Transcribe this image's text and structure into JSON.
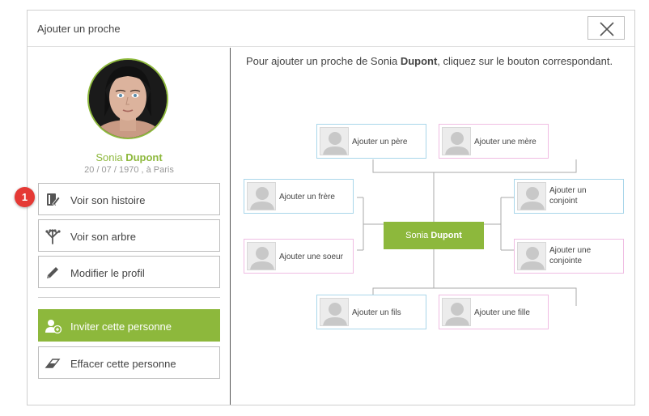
{
  "dialog": {
    "title": "Ajouter un proche",
    "close_icon": "close-icon"
  },
  "profile": {
    "first_name": "Sonia",
    "last_name": "Dupont",
    "birth": "20 / 07 / 1970 , à Paris"
  },
  "menu": {
    "story": {
      "label": "Voir son histoire",
      "icon": "book-edit-icon"
    },
    "tree": {
      "label": "Voir son arbre",
      "icon": "tree-icon"
    },
    "edit": {
      "label": "Modifier le profil",
      "icon": "pencil-icon"
    },
    "invite": {
      "label": "Inviter cette personne",
      "icon": "user-add-icon"
    },
    "erase": {
      "label": "Effacer cette personne",
      "icon": "eraser-icon"
    }
  },
  "badge": {
    "value": "1"
  },
  "instruction": {
    "prefix": "Pour ajouter un proche de Sonia ",
    "name": "Dupont",
    "suffix": ", cliquez sur le bouton correspondant."
  },
  "tree": {
    "center_first": "Sonia ",
    "center_last": "Dupont",
    "father": "Ajouter un père",
    "mother": "Ajouter une mère",
    "brother": "Ajouter un frère",
    "sister": "Ajouter une soeur",
    "husband": "Ajouter un conjoint",
    "wife": "Ajouter une conjointe",
    "son": "Ajouter un fils",
    "daughter": "Ajouter une fille"
  },
  "colors": {
    "accent": "#8db83c",
    "male_border": "#a9d6ea",
    "female_border": "#f0bde3",
    "badge": "#e53935"
  }
}
